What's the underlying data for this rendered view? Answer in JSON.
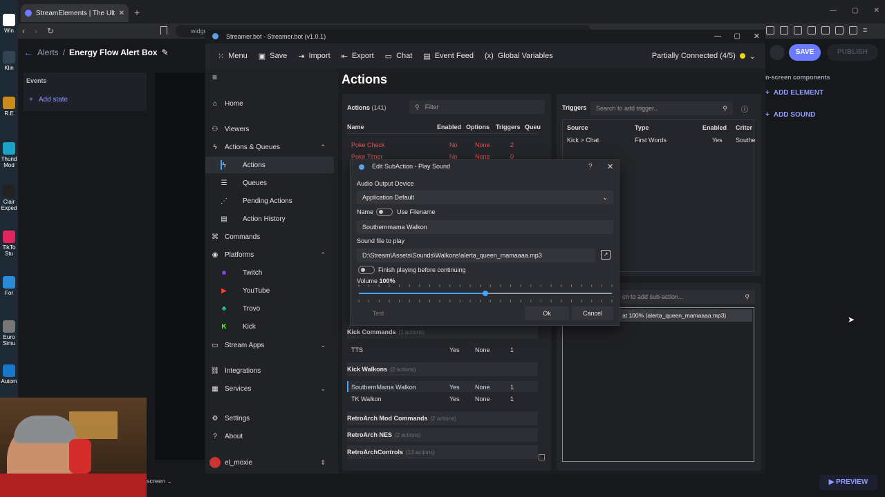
{
  "desktop": {
    "icons": [
      "Win",
      "Klin",
      "R.E",
      "Thund Mod",
      "Clair Exped",
      "TikTo Stu",
      "For",
      "Euro Simu",
      "Autom"
    ]
  },
  "browser": {
    "tab_title": "StreamElements | The Ultimate S",
    "url": "widge",
    "new_tab": "+"
  },
  "se": {
    "crumb_parent": "Alerts",
    "crumb_sep": "/",
    "crumb_title": "Energy Flow Alert Box",
    "events_label": "Events",
    "add_state": "Add state",
    "save": "SAVE",
    "publish": "PUBLISH",
    "onscreen": "n-screen components",
    "add_element": "ADD ELEMENT",
    "add_sound": "ADD SOUND",
    "preview": "PREVIEW",
    "screen": "screen"
  },
  "sb": {
    "window_title": "Streamer.bot - Streamer.bot (v1.0.1)",
    "toolbar": {
      "menu": "Menu",
      "save": "Save",
      "import": "Import",
      "export": "Export",
      "chat": "Chat",
      "event_feed": "Event Feed",
      "global_vars": "Global Variables",
      "status": "Partially Connected (4/5)"
    },
    "nav": {
      "home": "Home",
      "viewers": "Viewers",
      "actions_queues": "Actions & Queues",
      "actions": "Actions",
      "queues": "Queues",
      "pending": "Pending Actions",
      "history": "Action History",
      "commands": "Commands",
      "platforms": "Platforms",
      "twitch": "Twitch",
      "youtube": "YouTube",
      "trovo": "Trovo",
      "kick": "Kick",
      "stream_apps": "Stream Apps",
      "integrations": "Integrations",
      "services": "Services",
      "settings": "Settings",
      "about": "About",
      "user": "el_moxie"
    },
    "main_title": "Actions",
    "actions_label": "Actions",
    "actions_count": "(141)",
    "filter_placeholder": "Filter",
    "cols": {
      "name": "Name",
      "enabled": "Enabled",
      "options": "Options",
      "triggers": "Triggers",
      "queue": "Queu"
    },
    "top_rows": [
      {
        "name": "Poke Check",
        "enabled": "No",
        "options": "None",
        "triggers": "2"
      },
      {
        "name": "Poke Timer",
        "enabled": "No",
        "options": "None",
        "triggers": "0"
      }
    ],
    "groups": {
      "kick_commands": "Kick Commands",
      "kick_commands_count": "(1 actions)",
      "kick_walkons": "Kick Walkons",
      "kick_walkons_count": "(2 actions)",
      "retro_mod": "RetroArch Mod Commands",
      "retro_mod_count": "(2 actions)",
      "retro_nes": "RetroArch NES",
      "retro_nes_count": "(2 actions)",
      "retro_controls": "RetroArchControls",
      "retro_controls_count": "(13 actions)"
    },
    "rows": {
      "tts": {
        "name": "TTS",
        "enabled": "Yes",
        "options": "None",
        "triggers": "1"
      },
      "sm": {
        "name": "SouthernMama Walkon",
        "enabled": "Yes",
        "options": "None",
        "triggers": "1"
      },
      "tk": {
        "name": "TK Walkon",
        "enabled": "Yes",
        "options": "None",
        "triggers": "1"
      }
    },
    "triggers": {
      "label": "Triggers",
      "search_placeholder": "Search to add trigger...",
      "cols": {
        "source": "Source",
        "type": "Type",
        "enabled": "Enabled",
        "criteria": "Criter"
      },
      "row": {
        "source": "Kick > Chat",
        "type": "First Words",
        "enabled": "Yes",
        "criteria": "Southe"
      }
    },
    "sub": {
      "search_placeholder": "ch to add sub-action...",
      "item": "at 100% (alerta_queen_mamaaaa.mp3)"
    },
    "dialog": {
      "title": "Edit SubAction - Play Sound",
      "help": "?",
      "audio_label": "Audio Output Device",
      "audio_value": "Application Default",
      "name_label": "Name",
      "use_filename": "Use Filename",
      "name_value": "Southernmama Walkon",
      "sound_label": "Sound file to play",
      "sound_value": "D:\\Stream\\Assets\\Sounds\\Walkons\\alerta_queen_mamaaaa.mp3",
      "finish_label": "Finish playing before continuing",
      "volume_label": "Volume",
      "volume_value": "100%",
      "volume_fraction": 0.5,
      "test": "Test",
      "ok": "Ok",
      "cancel": "Cancel"
    }
  },
  "colors": {
    "accent": "#3ea6ff",
    "se_accent": "#6b7cff",
    "kick": "#53fc18",
    "twitch": "#9146ff",
    "youtube": "#ff3d2e",
    "trovo": "#1bd67f",
    "status_dot": "#f2d600"
  }
}
